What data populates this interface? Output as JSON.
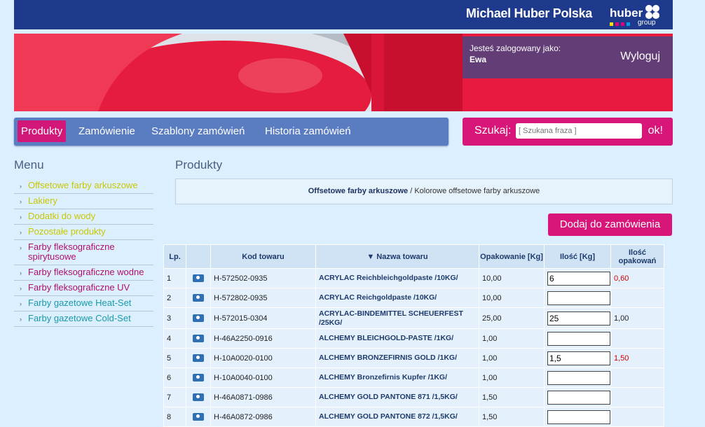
{
  "header": {
    "brand": "Michael Huber Polska",
    "logo_text": "huber",
    "logo_sub": "group"
  },
  "login": {
    "label": "Jesteś zalogowany jako:",
    "user": "Ewa",
    "logout": "Wyloguj"
  },
  "nav": [
    "Produkty",
    "Zamówienie",
    "Szablony zamówień",
    "Historia zamówień"
  ],
  "search": {
    "label": "Szukaj:",
    "placeholder": "[ Szukana fraza ]",
    "button": "ok!"
  },
  "menu": {
    "title": "Menu",
    "items": [
      {
        "label": "Offsetowe farby arkuszowe",
        "color": "#c8c800"
      },
      {
        "label": "Lakiery",
        "color": "#c8c800"
      },
      {
        "label": "Dodatki do wody",
        "color": "#c8c800"
      },
      {
        "label": "Pozostałe produkty",
        "color": "#c8c800"
      },
      {
        "label": "Farby fleksograficzne spirytusowe",
        "color": "#b0106a"
      },
      {
        "label": "Farby fleksograficzne wodne",
        "color": "#b0106a"
      },
      {
        "label": "Farby fleksograficzne UV",
        "color": "#b0106a"
      },
      {
        "label": "Farby gazetowe Heat-Set",
        "color": "#1a9aa8"
      },
      {
        "label": "Farby gazetowe Cold-Set",
        "color": "#1a9aa8"
      }
    ]
  },
  "main": {
    "title": "Produkty",
    "crumb_main": "Offsetowe farby arkuszowe",
    "crumb_sub": " / Kolorowe offsetowe farby arkuszowe",
    "add_button": "Dodaj do zamówienia"
  },
  "table": {
    "headers": [
      "Lp.",
      "",
      "Kod towaru",
      "▼ Nazwa towaru",
      "Opakowanie [Kg]",
      "Ilość [Kg]",
      "Ilość opakowań"
    ],
    "rows": [
      {
        "lp": "1",
        "code": "H-572502-0935",
        "name": "ACRYLAC Reichbleichgoldpaste /10KG/",
        "pack": "10,00",
        "qty": "6",
        "count": "0,60",
        "red": true
      },
      {
        "lp": "2",
        "code": "H-572802-0935",
        "name": "ACRYLAC Reichgoldpaste /10KG/",
        "pack": "10,00",
        "qty": "",
        "count": "",
        "red": false
      },
      {
        "lp": "3",
        "code": "H-572015-0304",
        "name": "ACRYLAC-BINDEMITTEL SCHEUERFEST /25KG/",
        "pack": "25,00",
        "qty": "25",
        "count": "1,00",
        "red": false
      },
      {
        "lp": "4",
        "code": "H-46A2250-0916",
        "name": "ALCHEMY BLEICHGOLD-PASTE /1KG/",
        "pack": "1,00",
        "qty": "",
        "count": "",
        "red": false
      },
      {
        "lp": "5",
        "code": "H-10A0020-0100",
        "name": "ALCHEMY BRONZEFIRNIS GOLD /1KG/",
        "pack": "1,00",
        "qty": "1,5",
        "count": "1,50",
        "red": true
      },
      {
        "lp": "6",
        "code": "H-10A0040-0100",
        "name": "ALCHEMY Bronzefirnis Kupfer /1KG/",
        "pack": "1,00",
        "qty": "",
        "count": "",
        "red": false
      },
      {
        "lp": "7",
        "code": "H-46A0871-0986",
        "name": "ALCHEMY GOLD PANTONE 871 /1,5KG/",
        "pack": "1,50",
        "qty": "",
        "count": "",
        "red": false
      },
      {
        "lp": "8",
        "code": "H-46A0872-0986",
        "name": "ALCHEMY GOLD PANTONE 872 /1,5KG/",
        "pack": "1,50",
        "qty": "",
        "count": "",
        "red": false
      }
    ]
  }
}
